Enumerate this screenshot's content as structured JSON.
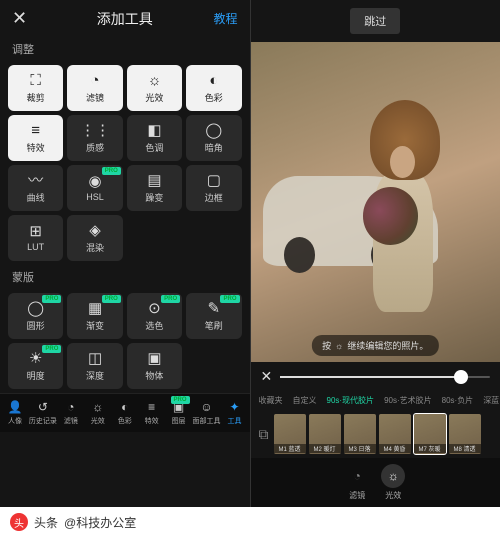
{
  "left": {
    "title": "添加工具",
    "tutorial": "教程",
    "section1": "调整",
    "section2": "蒙版",
    "row1": [
      {
        "icon": "crop",
        "label": "裁剪"
      },
      {
        "icon": "drop",
        "label": "滤镜"
      },
      {
        "icon": "sun",
        "label": "光效"
      },
      {
        "icon": "drop2",
        "label": "色彩"
      }
    ],
    "row2": [
      {
        "icon": "lines",
        "label": "特效",
        "white": true
      },
      {
        "icon": "grain",
        "label": "质感"
      },
      {
        "icon": "tone",
        "label": "色调"
      },
      {
        "icon": "vignette",
        "label": "暗角"
      }
    ],
    "row3": [
      {
        "icon": "curve",
        "label": "曲线"
      },
      {
        "icon": "hsl",
        "label": "HSL",
        "pro": true
      },
      {
        "icon": "grad",
        "label": "躁变"
      },
      {
        "icon": "frame",
        "label": "边框"
      }
    ],
    "row4": [
      {
        "icon": "lut",
        "label": "LUT"
      },
      {
        "icon": "blend",
        "label": "混染"
      }
    ],
    "mask_row": [
      {
        "icon": "circle",
        "label": "圆形",
        "pro": true
      },
      {
        "icon": "grad2",
        "label": "渐变",
        "pro": true
      },
      {
        "icon": "select",
        "label": "选色",
        "pro": true
      },
      {
        "icon": "brush",
        "label": "笔刷",
        "pro": true
      }
    ],
    "mask_row2": [
      {
        "icon": "bright",
        "label": "明度",
        "pro": true
      },
      {
        "icon": "depth",
        "label": "深度"
      },
      {
        "icon": "object",
        "label": "物体"
      }
    ],
    "bottom": [
      {
        "icon": "person",
        "label": "人像"
      },
      {
        "icon": "history",
        "label": "历史记录"
      },
      {
        "icon": "drop",
        "label": "滤镜"
      },
      {
        "icon": "sun",
        "label": "光效"
      },
      {
        "icon": "drop2",
        "label": "色彩"
      },
      {
        "icon": "lines",
        "label": "特效"
      },
      {
        "icon": "layers",
        "label": "图层",
        "pro": true
      },
      {
        "icon": "face",
        "label": "面部工具"
      },
      {
        "icon": "tools",
        "label": "工具",
        "active": true
      }
    ]
  },
  "right": {
    "skip": "跳过",
    "hint_pre": "按",
    "hint_post": "继续编辑您的照片。",
    "filter_tabs": [
      "收藏夹",
      "自定义",
      "90s·现代胶片",
      "90s·艺术胶片",
      "80s·负片",
      "深蓝"
    ],
    "active_tab": 2,
    "thumbs": [
      "M1 蓝透",
      "M2 暖灯",
      "M3 日落",
      "M4 黄昏",
      "M7 灰暖",
      "M8 清透"
    ],
    "selected_thumb": 4,
    "bottom": [
      {
        "icon": "drop",
        "label": "滤镜"
      },
      {
        "icon": "sun",
        "label": "光效",
        "active": true
      }
    ]
  },
  "footer": {
    "source_pre": "头条",
    "source": "@科技办公室"
  }
}
